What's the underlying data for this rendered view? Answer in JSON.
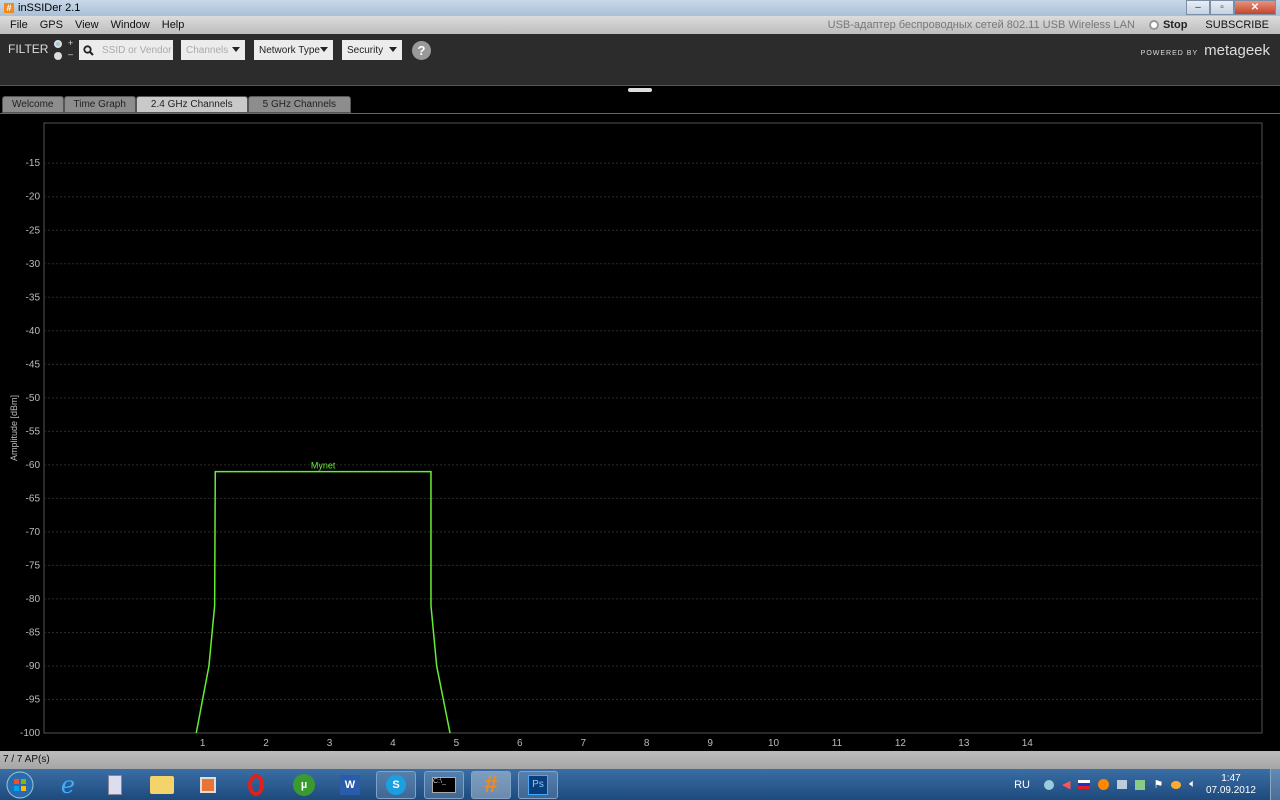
{
  "window": {
    "title": "inSSIDer 2.1",
    "app_icon": "#"
  },
  "menu": {
    "items": [
      "File",
      "GPS",
      "View",
      "Window",
      "Help"
    ],
    "adapter": "USB-адаптер беспроводных сетей 802.11 USB Wireless LAN",
    "stop_label": "Stop",
    "subscribe_label": "SUBSCRIBE"
  },
  "toolbar": {
    "filter_label": "FILTER",
    "plus": "+",
    "minus": "–",
    "search_placeholder": "SSID or Vendor",
    "channels_label": "Channels",
    "network_type_label": "Network Type",
    "security_label": "Security",
    "help": "?",
    "powered_by": "POWERED BY",
    "brand": "metageek"
  },
  "tabs": [
    {
      "label": "Welcome"
    },
    {
      "label": "Time Graph"
    },
    {
      "label": "2.4 GHz Channels",
      "active": true
    },
    {
      "label": "5 GHz Channels"
    }
  ],
  "chart_data": {
    "type": "line",
    "ylabel": "Amplitude [dBm]",
    "xlabel": "",
    "yticks": [
      -15,
      -20,
      -25,
      -30,
      -35,
      -40,
      -45,
      -50,
      -55,
      -60,
      -65,
      -70,
      -75,
      -80,
      -85,
      -90,
      -95,
      -100
    ],
    "xticks": [
      1,
      2,
      3,
      4,
      5,
      6,
      7,
      8,
      9,
      10,
      11,
      12,
      13,
      14
    ],
    "ylim": [
      -100,
      -9
    ],
    "xlim": [
      -1.5,
      17.7
    ],
    "grid": true,
    "series": [
      {
        "name": "Mynet",
        "color": "#66ee33",
        "points": [
          [
            0.9,
            -100
          ],
          [
            1.1,
            -90
          ],
          [
            1.19,
            -81
          ],
          [
            1.2,
            -61
          ],
          [
            4.6,
            -61
          ],
          [
            4.6,
            -81
          ],
          [
            4.69,
            -90
          ],
          [
            4.9,
            -100
          ]
        ],
        "label_x": 2.9
      }
    ]
  },
  "status": {
    "ap_count": "7 / 7 AP(s)"
  },
  "taskbar": {
    "apps": [
      "start",
      "internet-explorer",
      "calculator",
      "file-explorer",
      "media-player",
      "opera",
      "utorrent",
      "word",
      "skype",
      "cmd",
      "inssider",
      "photoshop"
    ],
    "lang": "RU",
    "time": "1:47",
    "date": "07.09.2012"
  }
}
